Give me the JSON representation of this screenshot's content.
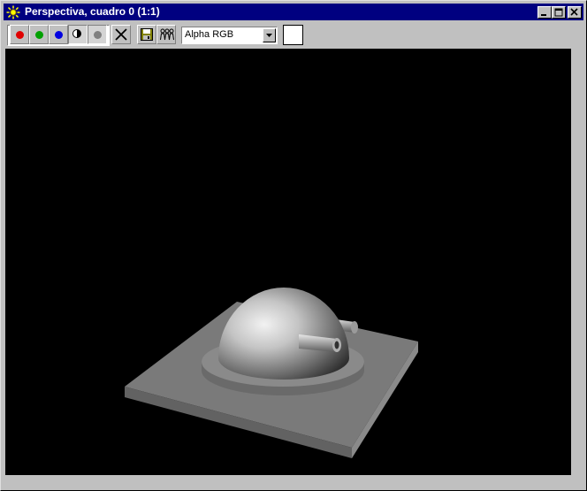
{
  "window": {
    "title": "Perspectiva, cuadro 0 (1:1)"
  },
  "titlebar_buttons": [
    "minimize-icon",
    "maximize-icon",
    "close-icon"
  ],
  "toolbar": {
    "channels": [
      {
        "name": "red-channel",
        "color": "#e00000"
      },
      {
        "name": "green-channel",
        "color": "#00a000"
      },
      {
        "name": "blue-channel",
        "color": "#0000e0"
      },
      {
        "name": "alpha-channel",
        "icon": "half-circle-icon"
      },
      {
        "name": "mono-channel",
        "color": "#808080"
      }
    ],
    "clear_icon": "x-icon",
    "save_icon": "floppy-disk-icon",
    "clone_icon": "people-icon",
    "channel_display": {
      "value": "Alpha RGB"
    },
    "background_color": "#ffffff"
  },
  "viewport": {
    "background": "#000000",
    "scene": "rendered-3d-object"
  }
}
